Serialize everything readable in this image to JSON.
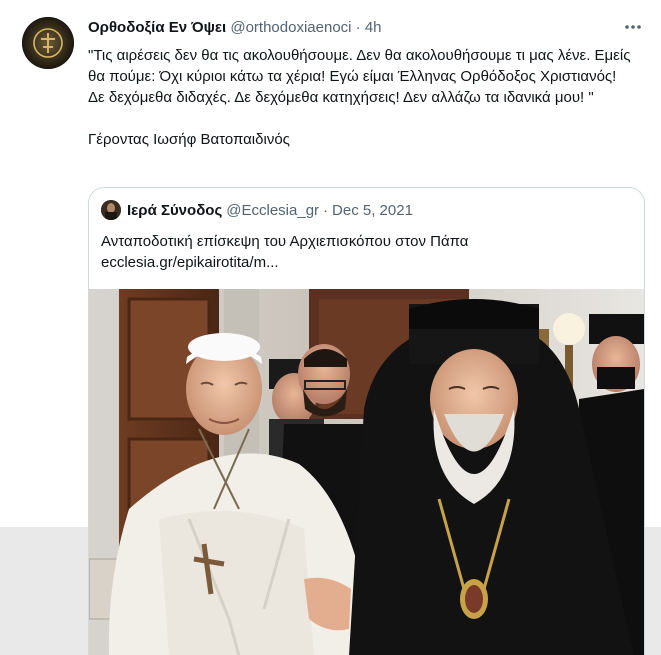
{
  "tweet": {
    "author_name": "Ορθοδοξία Εν Όψει",
    "author_handle": "@orthodoxiaenoci",
    "separator": "·",
    "time": "4h",
    "more_icon": "more-horizontal-icon",
    "text": "\"Τις αιρέσεις δεν θα τις ακολουθήσουμε. Δεν θα ακολουθήσουμε τι μας λένε. Εμείς θα πούμε: Όχι κύριοι κάτω τα χέρια! Εγώ είμαι Έλληνας Ορθόδοξος Χριστιανός! Δε δεχόμεθα διδαχές. Δε δεχόμεθα κατηχήσεις! Δεν αλλάζω τα ιδανικά μου! \"",
    "signature": "Γέροντας Ιωσήφ Βατοπαιδινός"
  },
  "quoted": {
    "author_name": "Ιερά Σύνοδος",
    "author_handle": "@Ecclesia_gr",
    "separator": "·",
    "date": "Dec 5, 2021",
    "text_line1": "Ανταποδοτική επίσκεψη του Αρχιεπισκόπου στον Πάπα",
    "link": "ecclesia.gr/epikairotita/m..."
  },
  "colors": {
    "text": "#0f1419",
    "secondary": "#536471",
    "border": "#cfd9de",
    "background": "#ffffff"
  }
}
